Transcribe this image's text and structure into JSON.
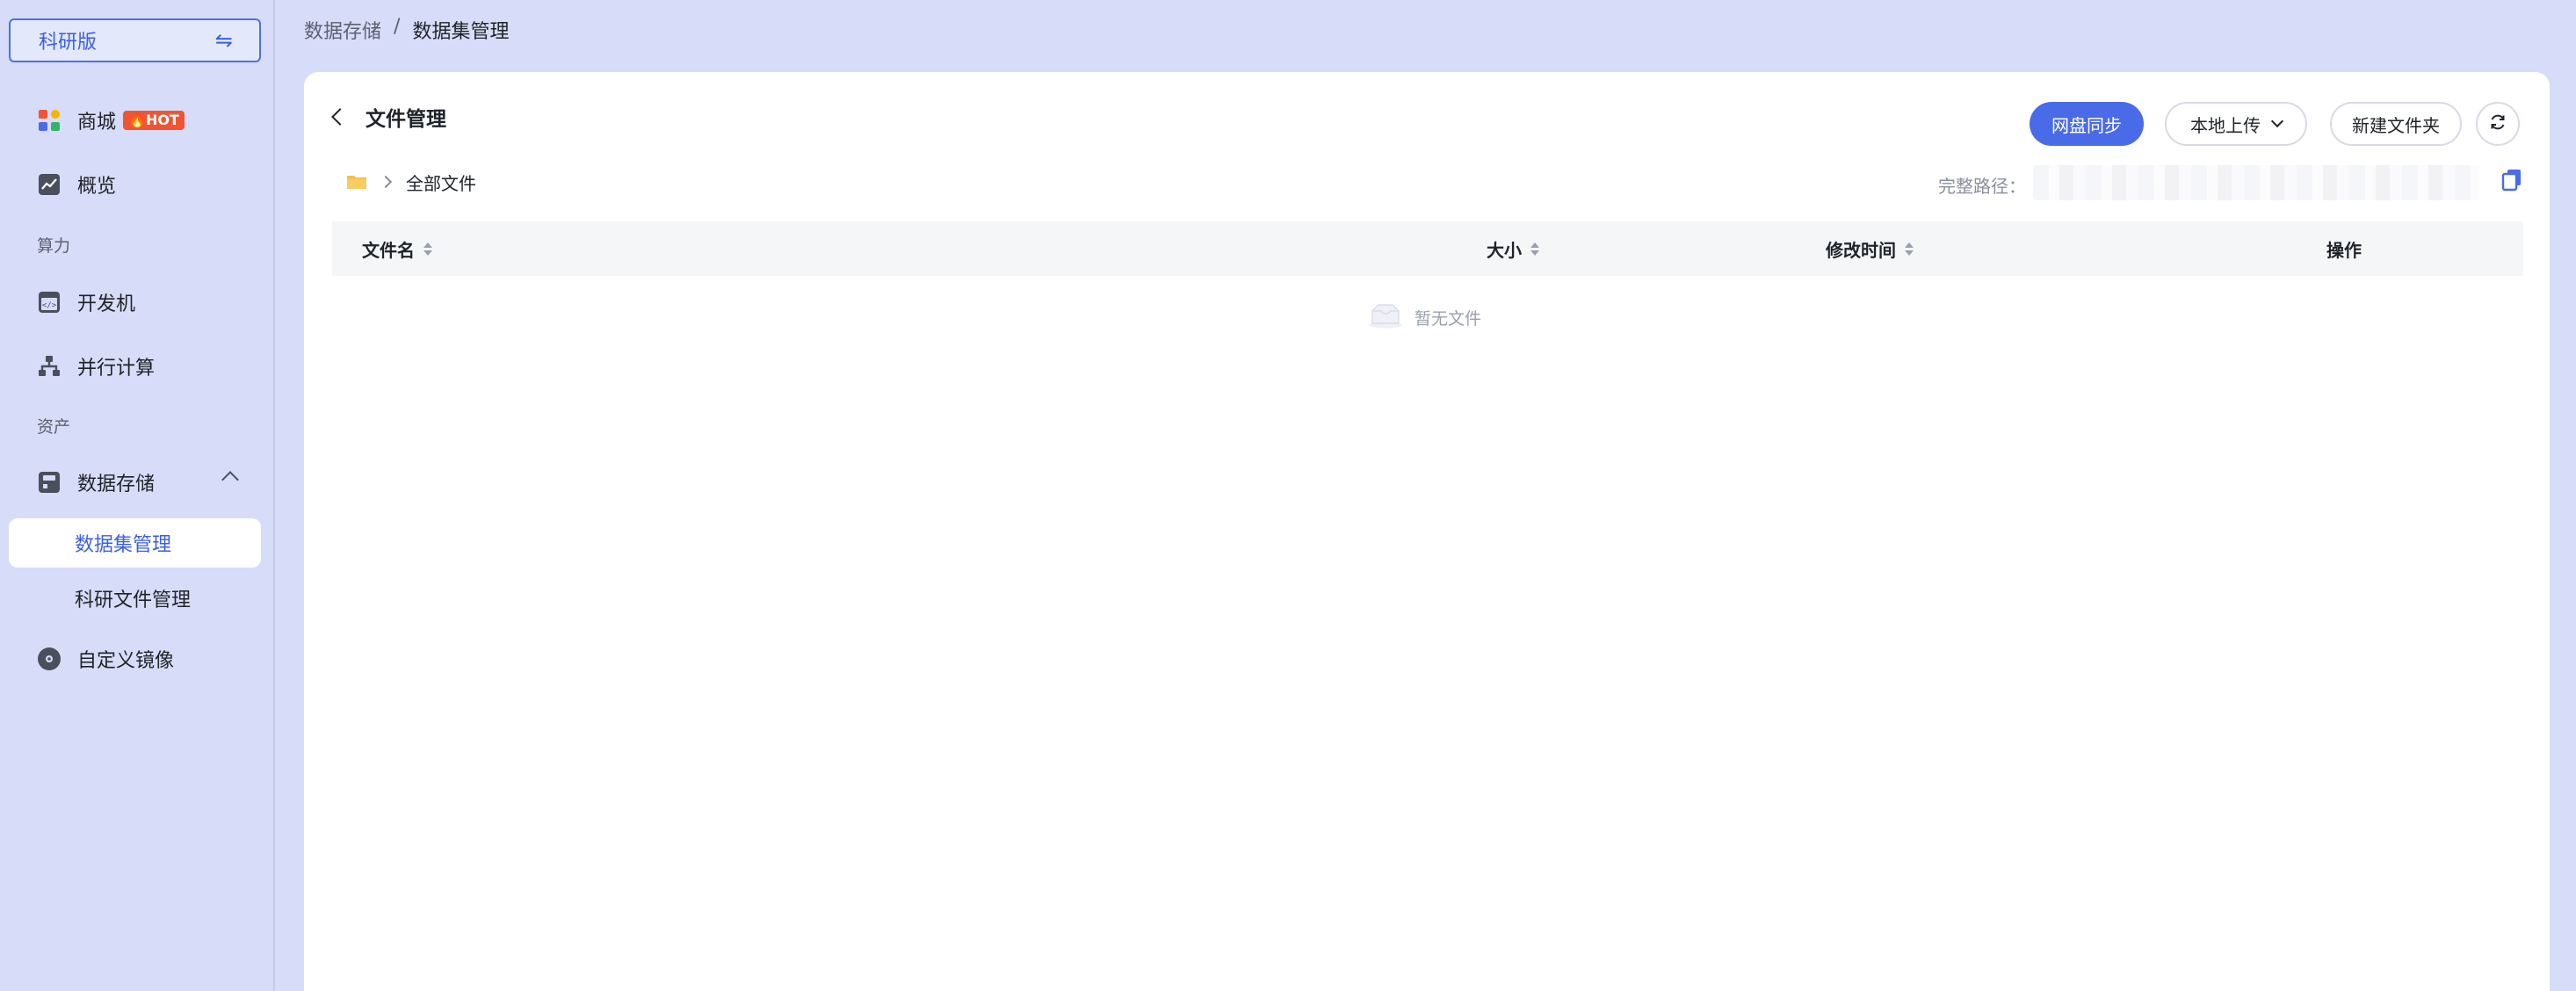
{
  "sidebar": {
    "edition_label": "科研版",
    "items": [
      {
        "label": "商城",
        "badge": "HOT",
        "icon": "store-icon"
      },
      {
        "label": "概览",
        "icon": "chart-icon"
      },
      {
        "label": "开发机",
        "icon": "code-window-icon"
      },
      {
        "label": "并行计算",
        "icon": "hierarchy-icon"
      },
      {
        "label": "数据存储",
        "icon": "storage-icon"
      },
      {
        "label": "数据集管理"
      },
      {
        "label": "科研文件管理"
      },
      {
        "label": "自定义镜像",
        "icon": "disc-icon"
      }
    ],
    "sections": {
      "compute": "算力",
      "assets": "资产"
    }
  },
  "top_breadcrumb": {
    "parent": "数据存储",
    "separator": "/",
    "current": "数据集管理"
  },
  "main": {
    "title": "文件管理",
    "buttons": {
      "sync": "网盘同步",
      "upload": "本地上传",
      "new_folder": "新建文件夹"
    },
    "path": {
      "root": "全部文件",
      "full_path_label": "完整路径："
    },
    "table": {
      "columns": [
        "文件名",
        "大小",
        "修改时间",
        "操作"
      ],
      "rows": [],
      "empty_text": "暂无文件"
    }
  },
  "colors": {
    "accent": "#4a6be8",
    "sidebar_bg": "#d7dcf8",
    "hot": "#ef5533"
  }
}
